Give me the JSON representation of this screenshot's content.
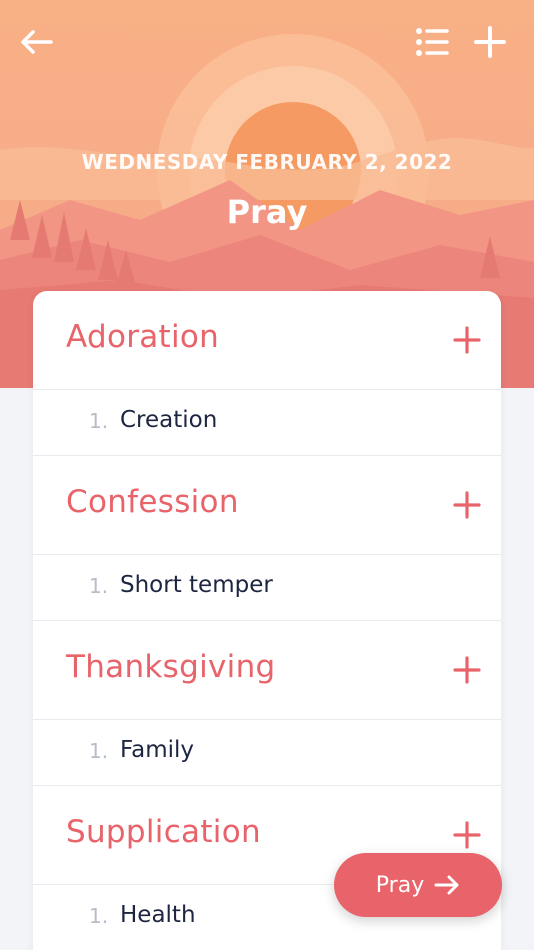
{
  "header": {
    "date": "WEDNESDAY FEBRUARY 2, 2022",
    "title": "Pray",
    "back_icon": "arrow-left-icon",
    "list_icon": "list-icon",
    "add_icon": "plus-icon"
  },
  "sections": [
    {
      "title": "Adoration",
      "items": [
        {
          "num": "1.",
          "text": "Creation"
        }
      ]
    },
    {
      "title": "Confession",
      "items": [
        {
          "num": "1.",
          "text": "Short temper"
        }
      ]
    },
    {
      "title": "Thanksgiving",
      "items": [
        {
          "num": "1.",
          "text": "Family"
        }
      ]
    },
    {
      "title": "Supplication",
      "items": [
        {
          "num": "1.",
          "text": "Health"
        }
      ]
    }
  ],
  "pray_button": {
    "label": "Pray",
    "icon": "arrow-right-icon"
  },
  "colors": {
    "accent": "#e8636a",
    "text_dark": "#1d2540",
    "number_gray": "#b6bcc8",
    "hero_sky": "#f9b48a",
    "hero_sun": "#f59a62"
  }
}
